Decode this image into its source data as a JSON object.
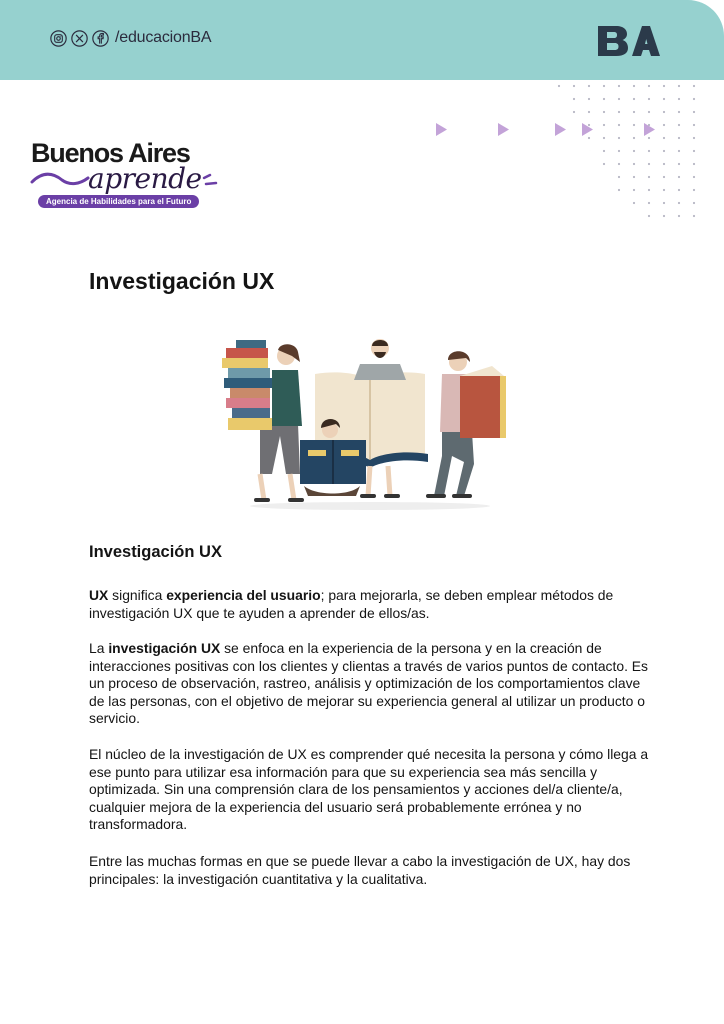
{
  "header": {
    "social_icons": [
      "instagram-icon",
      "x-icon",
      "facebook-icon"
    ],
    "handle": "/educacionBA",
    "logo_text": "BA",
    "accent_color": "#96d1cf",
    "triangle_color": "#c3a3d8"
  },
  "brand": {
    "title": "Buenos Aires",
    "script": "aprende",
    "tagline": "Agencia de Habilidades para el Futuro",
    "pill_color": "#6b3fa6"
  },
  "page_title": "Investigación UX",
  "section": {
    "title": "Investigación UX",
    "p1": {
      "b1": "UX",
      "t1": " significa ",
      "b2": "experiencia del usuario",
      "t2": "; para mejorarla, se deben emplear métodos de investigación UX que te ayuden a aprender de ellos/as."
    },
    "p2": {
      "t1": "La ",
      "b1": "investigación UX",
      "t2": " se enfoca en la experiencia de la persona y en la creación de interacciones positivas con los clientes y clientas a través de varios puntos de contacto. Es un proceso de observación, rastreo, análisis y optimización de los comportamientos clave de las personas, con el objetivo de mejorar su experiencia general al utilizar un producto o servicio."
    },
    "p3": "El núcleo de la investigación de UX es comprender qué necesita la persona y cómo llega a ese punto para utilizar esa información para que su experiencia sea más sencilla y optimizada. Sin una comprensión clara de los pensamientos y acciones del/a cliente/a, cualquier mejora de la experiencia del usuario será probablemente errónea y no transformadora.",
    "p4": "Entre las muchas formas en que se puede llevar a cabo la investigación de UX, hay dos principales: la investigación cuantitativa y la cualitativa."
  }
}
